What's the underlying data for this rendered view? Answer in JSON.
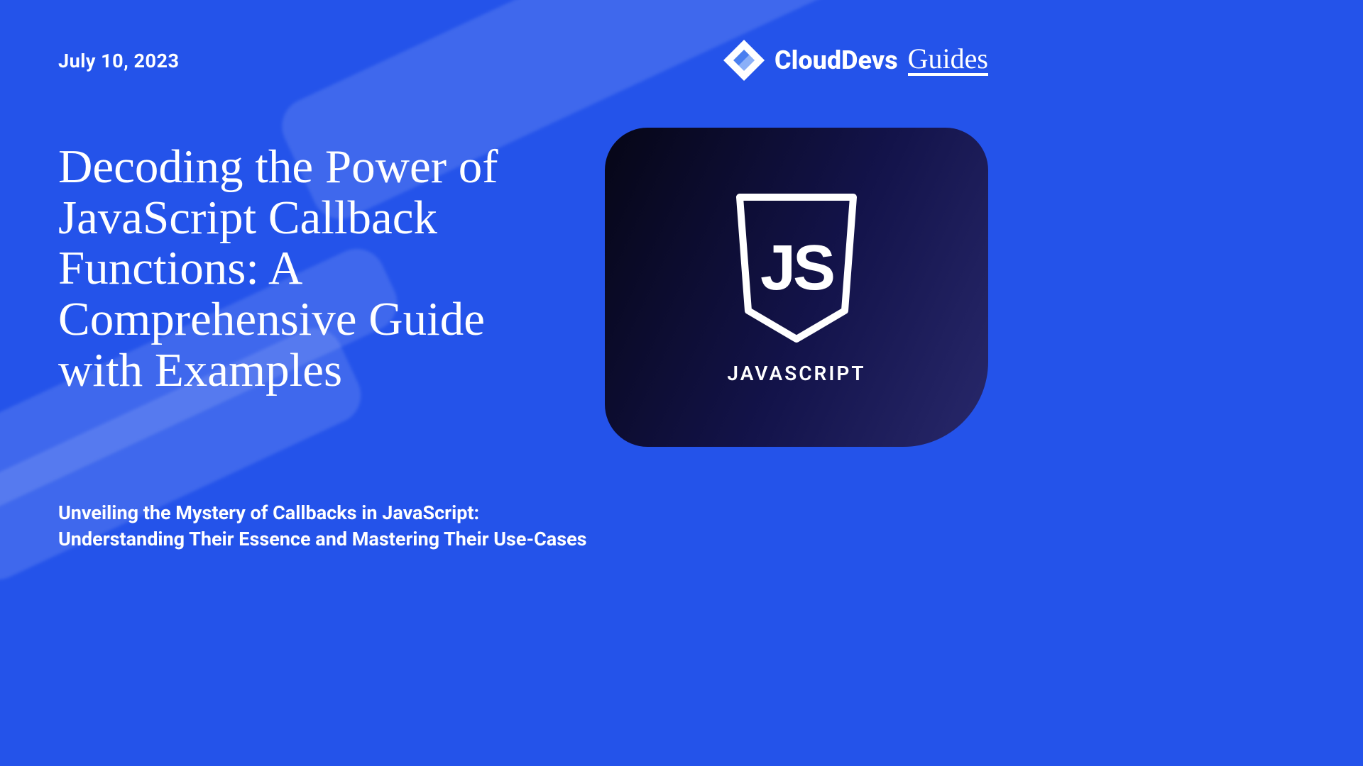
{
  "date": "July 10,  2023",
  "brand": {
    "name": "CloudDevs",
    "suffix": "Guides"
  },
  "title": "Decoding the Power of JavaScript Callback Functions: A Comprehensive Guide with Examples",
  "subtitle_line1": "Unveiling the Mystery of Callbacks in JavaScript:",
  "subtitle_line2": "Understanding Their Essence and Mastering Their Use-Cases",
  "card": {
    "logo_letters": "JS",
    "label": "JAVASCRIPT"
  }
}
